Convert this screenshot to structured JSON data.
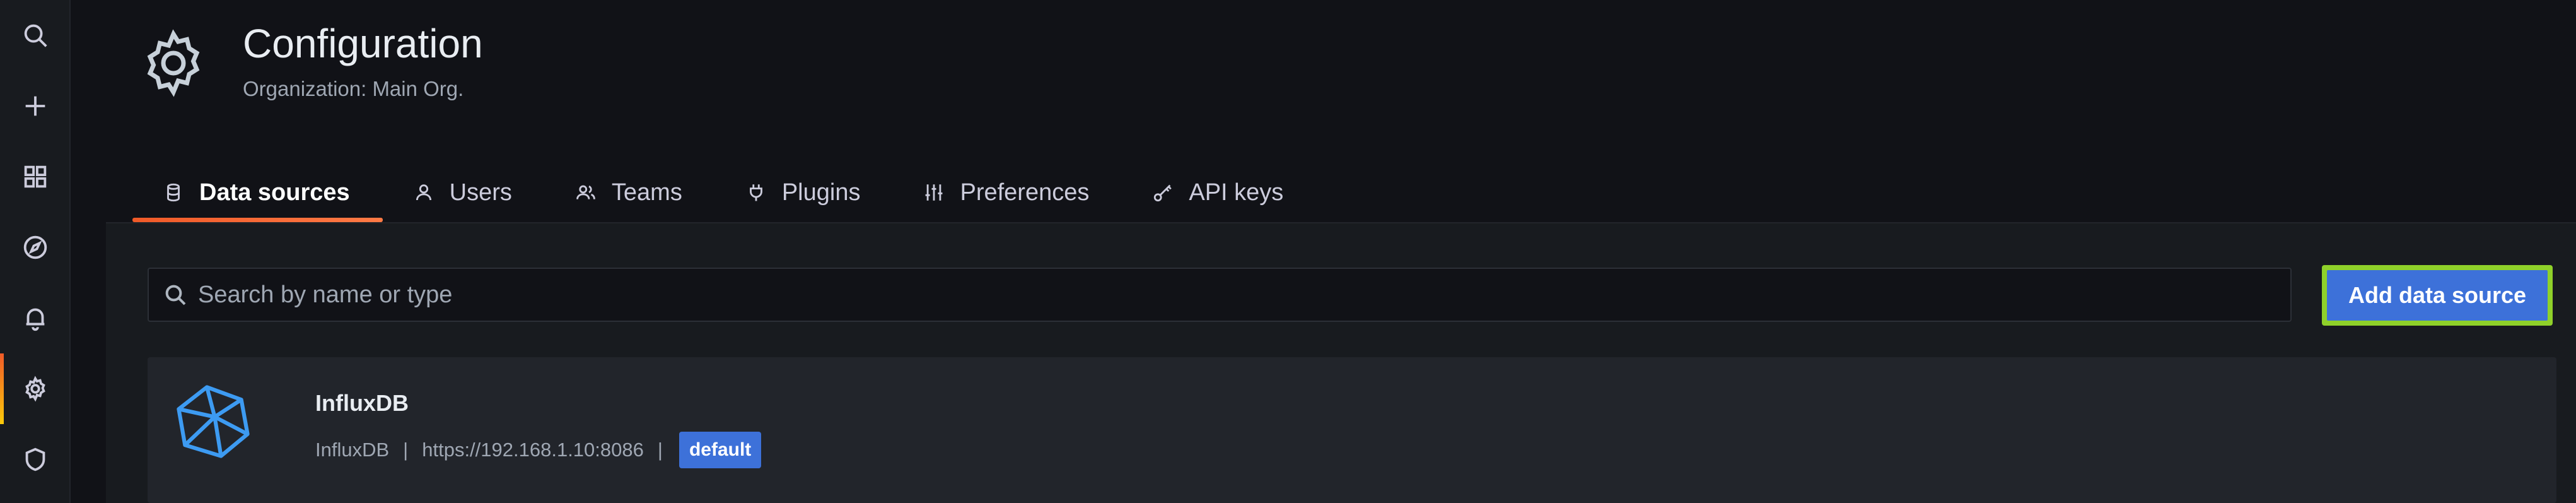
{
  "sidebar": {
    "items": [
      {
        "icon": "search-icon"
      },
      {
        "icon": "plus-icon"
      },
      {
        "icon": "dashboards-icon"
      },
      {
        "icon": "compass-icon"
      },
      {
        "icon": "bell-icon"
      },
      {
        "icon": "gear-icon",
        "active": true
      },
      {
        "icon": "shield-icon"
      }
    ]
  },
  "header": {
    "icon": "gear-icon",
    "title": "Configuration",
    "subtitle": "Organization: Main Org."
  },
  "tabs": [
    {
      "label": "Data sources",
      "icon": "database-icon",
      "active": true
    },
    {
      "label": "Users",
      "icon": "user-icon"
    },
    {
      "label": "Teams",
      "icon": "users-icon"
    },
    {
      "label": "Plugins",
      "icon": "plug-icon"
    },
    {
      "label": "Preferences",
      "icon": "sliders-icon"
    },
    {
      "label": "API keys",
      "icon": "key-icon"
    }
  ],
  "search": {
    "placeholder": "Search by name or type",
    "value": ""
  },
  "add_button": {
    "label": "Add data source"
  },
  "datasources": [
    {
      "name": "InfluxDB",
      "type": "InfluxDB",
      "url": "https://192.168.1.10:8086",
      "separator": "|",
      "badge": "default",
      "icon": "influxdb-logo-icon"
    }
  ],
  "colors": {
    "accent_orange": "#f05a28",
    "primary_blue": "#3d71d9",
    "highlight_green": "#8fd12a",
    "background": "#111217",
    "panel": "#181b1f",
    "card": "#22252b"
  }
}
